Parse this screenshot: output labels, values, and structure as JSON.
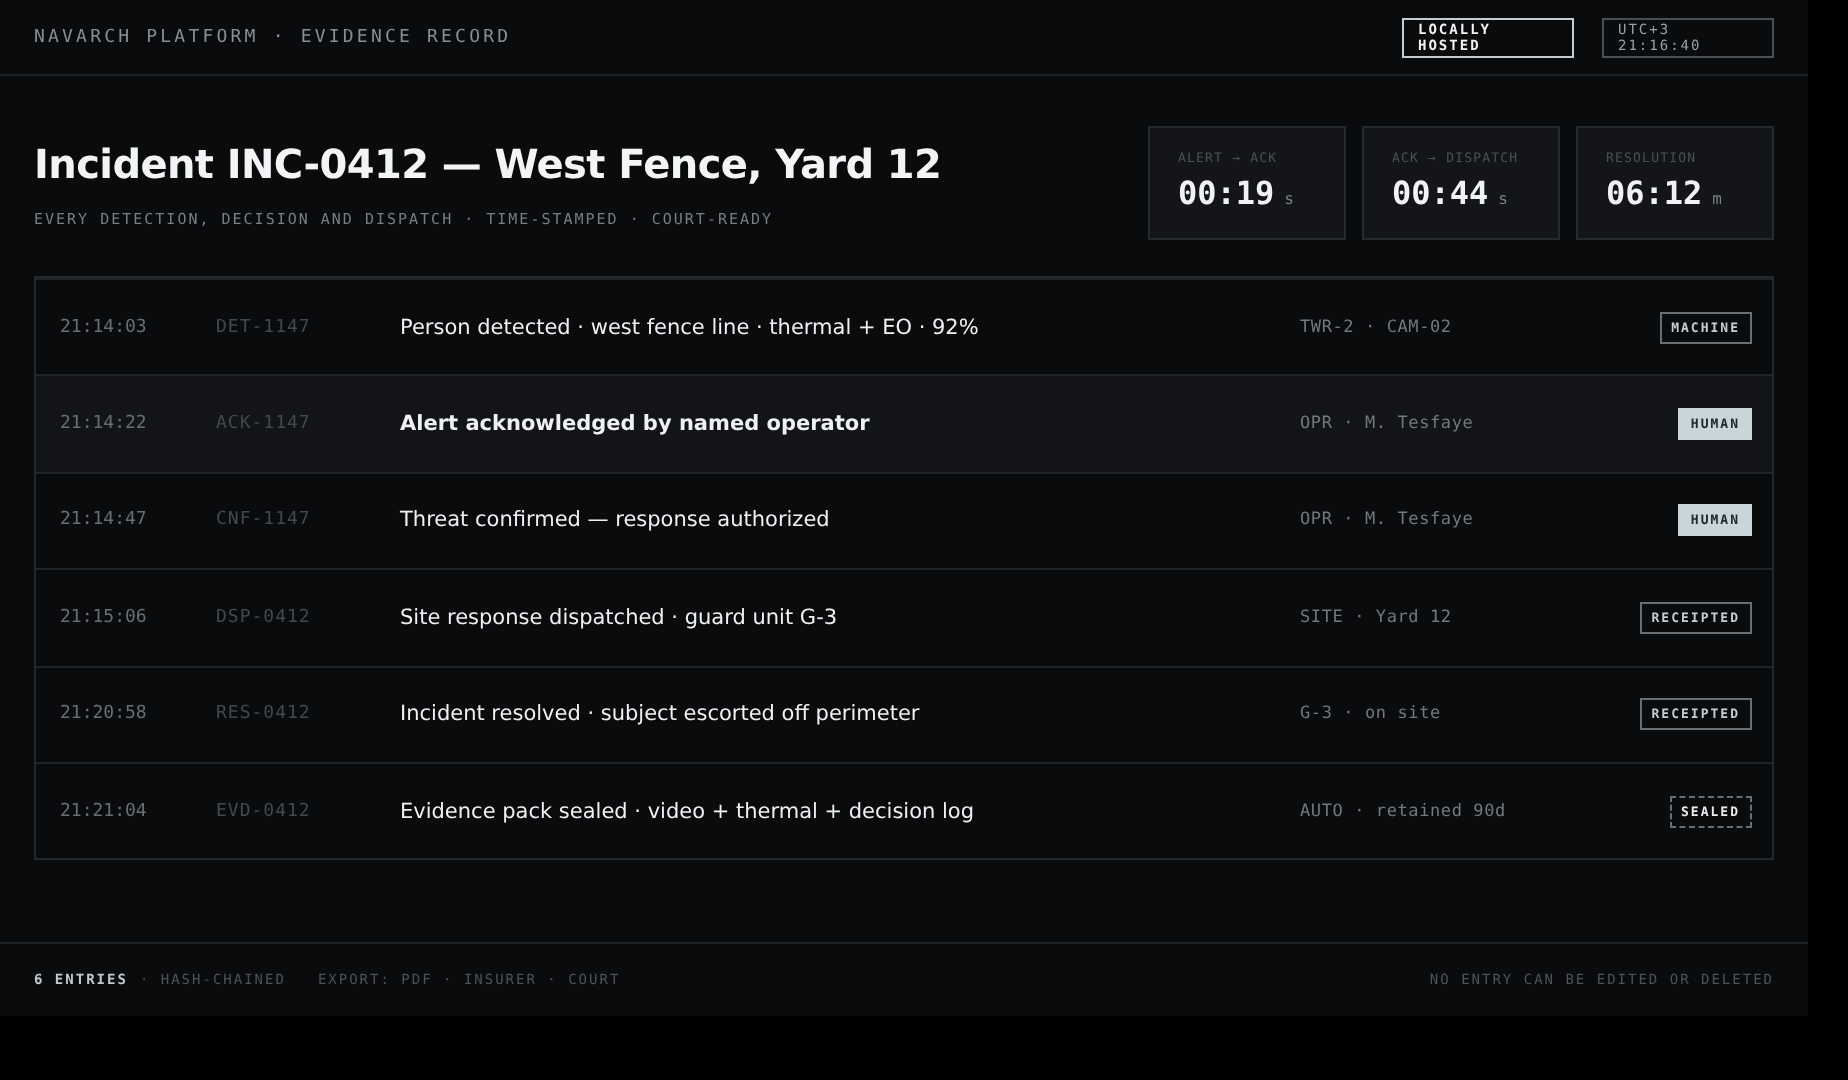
{
  "header": {
    "breadcrumb": "NAVARCH PLATFORM · EVIDENCE RECORD",
    "chips": [
      {
        "lines": [
          "LOCALLY",
          "HOSTED"
        ],
        "kind": "strong"
      },
      {
        "lines": [
          "UTC+3",
          "21:16:40"
        ],
        "kind": "muted"
      }
    ]
  },
  "incident": {
    "title": "Incident INC-0412 — West Fence, Yard 12",
    "subtitle": "EVERY DETECTION, DECISION AND DISPATCH · TIME-STAMPED · COURT-READY"
  },
  "metrics": [
    {
      "label": "ALERT → ACK",
      "value": "00:19",
      "unit": "s"
    },
    {
      "label": "ACK → DISPATCH",
      "value": "00:44",
      "unit": "s"
    },
    {
      "label": "RESOLUTION",
      "value": "06:12",
      "unit": "m"
    }
  ],
  "entries": [
    {
      "time": "21:14:03",
      "id": "DET-1147",
      "description": "Person detected · west fence line · thermal + EO · 92%",
      "source": "TWR-2 · CAM-02",
      "badge": {
        "text": "MACHINE",
        "kind": "outline"
      },
      "selected": false
    },
    {
      "time": "21:14:22",
      "id": "ACK-1147",
      "description": "Alert acknowledged by named operator",
      "source": "OPR · M. Tesfaye",
      "badge": {
        "text": "HUMAN",
        "kind": "filled"
      },
      "selected": true
    },
    {
      "time": "21:14:47",
      "id": "CNF-1147",
      "description": "Threat confirmed — response authorized",
      "source": "OPR · M. Tesfaye",
      "badge": {
        "text": "HUMAN",
        "kind": "filled"
      },
      "selected": false
    },
    {
      "time": "21:15:06",
      "id": "DSP-0412",
      "description": "Site response dispatched · guard unit G-3",
      "source": "SITE · Yard 12",
      "badge": {
        "text": "RECEIPTED",
        "kind": "outline"
      },
      "selected": false
    },
    {
      "time": "21:20:58",
      "id": "RES-0412",
      "description": "Incident resolved · subject escorted off perimeter",
      "source": "G-3 · on site",
      "badge": {
        "text": "RECEIPTED",
        "kind": "outline"
      },
      "selected": false
    },
    {
      "time": "21:21:04",
      "id": "EVD-0412",
      "description": "Evidence pack sealed · video + thermal + decision log",
      "source": "AUTO · retained 90d",
      "badge": {
        "text": "SEALED",
        "kind": "dashed"
      },
      "selected": false
    }
  ],
  "footer": {
    "count": "6 ENTRIES",
    "chain": "· HASH-CHAINED",
    "export": "EXPORT: PDF · INSURER · COURT",
    "notice": "NO ENTRY CAN BE EDITED OR DELETED"
  }
}
